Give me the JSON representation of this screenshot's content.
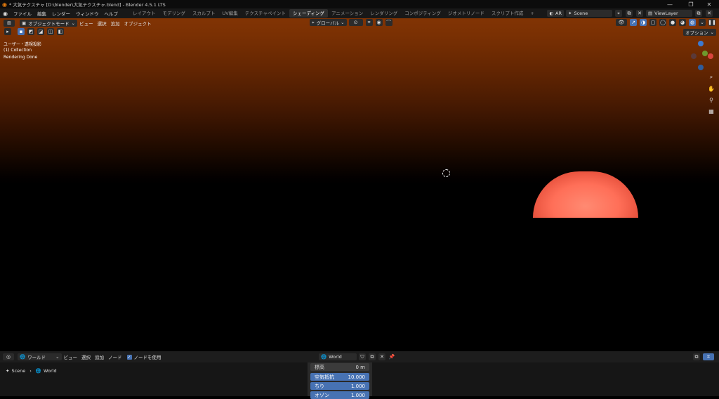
{
  "window": {
    "title": "* 大気テクスチャ [D:\\blender\\大気テクスチャ.blend] - Blender 4.5.1 LTS",
    "controls": [
      "—",
      "❐",
      "✕"
    ]
  },
  "menubar": {
    "menus": [
      "ファイル",
      "編集",
      "レンダー",
      "ウィンドウ",
      "ヘルプ"
    ],
    "workspaces": [
      "レイアウト",
      "モデリング",
      "スカルプト",
      "UV編集",
      "テクスチャペイント",
      "シェーディング",
      "アニメーション",
      "レンダリング",
      "コンポジティング",
      "ジオメトリノード",
      "スクリプト作成"
    ],
    "active_workspace": "シェーディング",
    "add_tab": "+",
    "ar_label": "AR",
    "scene": "Scene",
    "view_layer": "ViewLayer"
  },
  "viewport_header": {
    "mode": "オブジェクトモード",
    "menus": [
      "ビュー",
      "選択",
      "追加",
      "オブジェクト"
    ],
    "orientation": "グローバル",
    "options": "オプション"
  },
  "viewport_overlay": {
    "view_name": "ユーザー・透視投影",
    "collection": "(1) Collection",
    "status": "Rendering Done"
  },
  "gizmo": {
    "axes": [
      "Z",
      "X",
      "Y"
    ],
    "colors": {
      "x": "#d9453d",
      "y": "#6e9a2d",
      "z": "#3c7ad1"
    }
  },
  "node_header": {
    "type": "ワールド",
    "menus": [
      "ビュー",
      "選択",
      "追加",
      "ノード"
    ],
    "use_nodes": "ノードを使用",
    "use_nodes_checked": true,
    "world_name": "World"
  },
  "breadcrumb": {
    "scene": "Scene",
    "world": "World"
  },
  "sky_panel": {
    "rows": [
      {
        "label": "標高",
        "value": "0 m",
        "highlight": false
      },
      {
        "label": "空気抵抗",
        "value": "10.000",
        "highlight": true
      },
      {
        "label": "ちり",
        "value": "1.000",
        "highlight": true
      },
      {
        "label": "オゾン",
        "value": "1.000",
        "highlight": true
      }
    ]
  },
  "colors": {
    "accent": "#4772b3",
    "sun": "#ff7a64",
    "sky_top": "#813404"
  }
}
